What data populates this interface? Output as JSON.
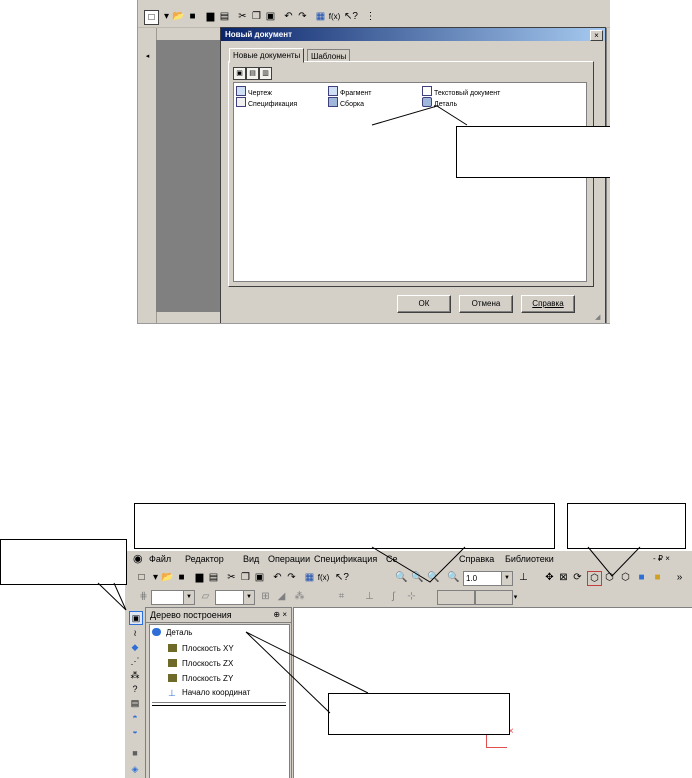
{
  "dialog": {
    "title": "Новый документ",
    "close": "×",
    "tabs": [
      {
        "label": "Новые документы"
      },
      {
        "label": "Шаблоны"
      }
    ],
    "items": [
      {
        "label": "Чертеж"
      },
      {
        "label": "Фрагмент"
      },
      {
        "label": "Текстовый документ"
      },
      {
        "label": "Спецификация"
      },
      {
        "label": "Сборка"
      },
      {
        "label": "Деталь"
      }
    ],
    "buttons": {
      "ok": "ОК",
      "cancel": "Отмена",
      "help": "Справка"
    }
  },
  "app": {
    "menu": [
      {
        "label": "Файл"
      },
      {
        "label": "Редактор"
      },
      {
        "label": "Вид"
      },
      {
        "label": "Операции"
      },
      {
        "label": "Спецификация"
      },
      {
        "label": "Се"
      },
      {
        "label": "Справка"
      },
      {
        "label": "Библиотеки"
      }
    ],
    "window_controls": "- ₽ ×",
    "zoom_value": "1.0",
    "tree": {
      "title": "Дерево построения",
      "pin": "⊕ ×",
      "nodes": [
        {
          "label": "Деталь"
        },
        {
          "label": "Плоскость XY"
        },
        {
          "label": "Плоскость ZX"
        },
        {
          "label": "Плоскость ZY"
        },
        {
          "label": "Начало координат"
        }
      ]
    }
  },
  "colors": {
    "window_bg": "#d4d0c8",
    "title_from": "#0a246a",
    "title_to": "#a6caf0",
    "grey_area": "#808080"
  }
}
